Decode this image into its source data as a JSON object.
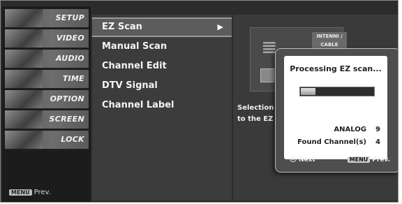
{
  "sidebar": {
    "items": [
      {
        "label": "SETUP"
      },
      {
        "label": "VIDEO"
      },
      {
        "label": "AUDIO"
      },
      {
        "label": "TIME"
      },
      {
        "label": "OPTION"
      },
      {
        "label": "SCREEN"
      },
      {
        "label": "LOCK"
      }
    ],
    "prev_key": "MENU",
    "prev_label": "Prev."
  },
  "submenu": {
    "items": [
      {
        "label": "EZ Scan",
        "arrow": "▶"
      },
      {
        "label": "Manual Scan"
      },
      {
        "label": "Channel Edit"
      },
      {
        "label": "DTV Signal"
      },
      {
        "label": "Channel Label"
      }
    ]
  },
  "right": {
    "illustration_tag": "INTENNI / CABLE",
    "description": "Selection to the EZ"
  },
  "popup": {
    "title": "Processing EZ scan...",
    "progress": 0.2,
    "rows": [
      {
        "label": "ANALOG",
        "value": "9"
      },
      {
        "label": "Found Channel(s)",
        "value": "4"
      }
    ],
    "next_label": "Next",
    "prev_key": "MENU",
    "prev_label": "Prev."
  }
}
